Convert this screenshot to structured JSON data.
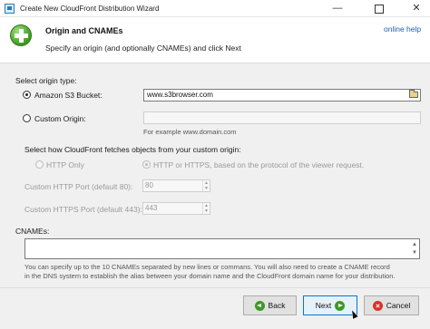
{
  "window": {
    "title": "Create New CloudFront Distribution Wizard",
    "minimize_glyph": "—",
    "close_glyph": "✕"
  },
  "header": {
    "title": "Origin and CNAMEs",
    "subtitle": "Specify an origin (and optionally CNAMEs) and click Next",
    "help_link": "online help",
    "icon": "green-plus-icon"
  },
  "origin": {
    "section_label": "Select origin type:",
    "s3_option_label": "Amazon S3 Bucket:",
    "s3_selected": true,
    "s3_value": "www.s3browser.com",
    "custom_option_label": "Custom Origin:",
    "custom_selected": false,
    "custom_value": "",
    "custom_example": "For example www.domain.com"
  },
  "fetch": {
    "section_label": "Select how CloudFront fetches objects from your custom origin:",
    "http_only_label": "HTTP Only",
    "http_or_https_label": "HTTP or HTTPS, based on the protocol of the viewer request.",
    "http_or_https_selected": true,
    "http_port_label": "Custom HTTP Port (default 80):",
    "http_port_value": "80",
    "https_port_label": "Custom HTTPS Port (default 443):",
    "https_port_value": "443"
  },
  "cnames": {
    "label": "CNAMEs:",
    "value": "",
    "help_text_1": "You can specify up to the 10 CNAMEs separated by new lines or commans. You will also need to create a CNAME record",
    "help_text_2": "in the DNS system to establish the alias between your domain name and the CloudFront domain name for your distribution."
  },
  "buttons": {
    "back": "Back",
    "next": "Next",
    "cancel": "Cancel"
  }
}
